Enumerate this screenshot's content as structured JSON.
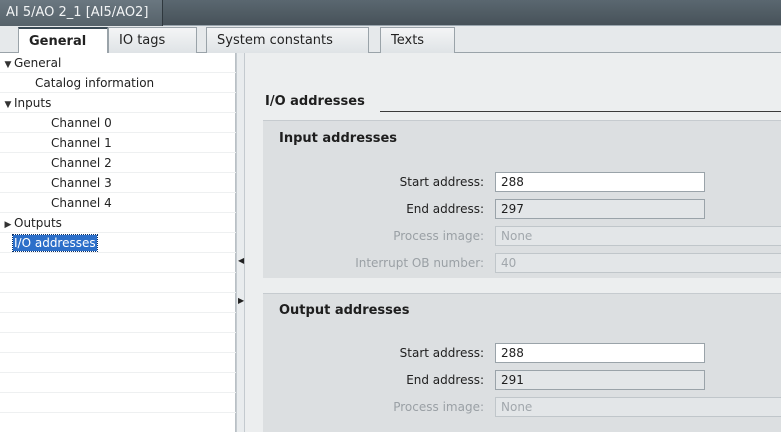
{
  "window": {
    "title": "AI 5/AO 2_1 [AI5/AO2]"
  },
  "tabs": [
    {
      "label": "General"
    },
    {
      "label": "IO tags"
    },
    {
      "label": "System constants"
    },
    {
      "label": "Texts"
    }
  ],
  "nav": {
    "items": [
      {
        "label": "General"
      },
      {
        "label": "Catalog information"
      },
      {
        "label": "Inputs"
      },
      {
        "label": "Channel 0"
      },
      {
        "label": "Channel 1"
      },
      {
        "label": "Channel 2"
      },
      {
        "label": "Channel 3"
      },
      {
        "label": "Channel 4"
      },
      {
        "label": "Outputs"
      },
      {
        "label": "I/O addresses"
      }
    ]
  },
  "content": {
    "section_title": "I/O addresses",
    "input_group": {
      "title": "Input addresses",
      "start_label": "Start address:",
      "start_value": "288",
      "end_label": "End address:",
      "end_value": "297",
      "process_label": "Process image:",
      "process_value": "None",
      "interrupt_label": "Interrupt OB number:",
      "interrupt_value": "40"
    },
    "output_group": {
      "title": "Output addresses",
      "start_label": "Start address:",
      "start_value": "288",
      "end_label": "End address:",
      "end_value": "291",
      "process_label": "Process image:",
      "process_value": "None"
    }
  }
}
